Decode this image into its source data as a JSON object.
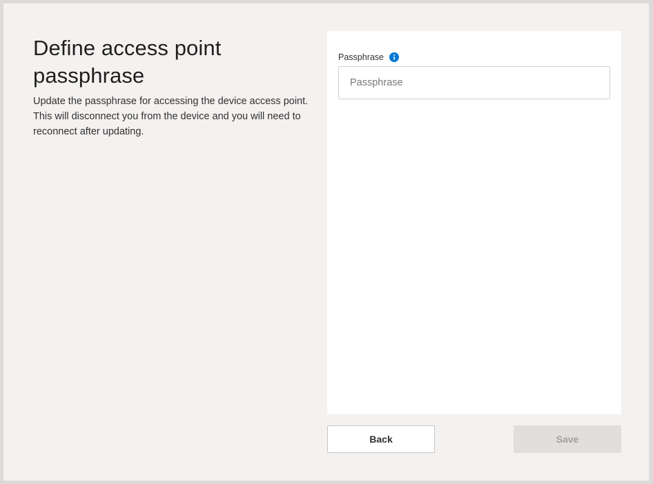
{
  "page": {
    "title": "Define access point passphrase",
    "description": "Update the passphrase for accessing the device access point. This will disconnect you from the device and you will need to reconnect after updating."
  },
  "form": {
    "passphrase": {
      "label": "Passphrase",
      "placeholder": "Passphrase",
      "value": "",
      "info_icon": "info-icon"
    }
  },
  "actions": {
    "back_label": "Back",
    "save_label": "Save",
    "save_disabled": true
  },
  "colors": {
    "accent": "#0078d4",
    "frame_background": "#f3f2f1",
    "card_background": "#ffffff",
    "disabled_button": "#e1dfdd"
  }
}
